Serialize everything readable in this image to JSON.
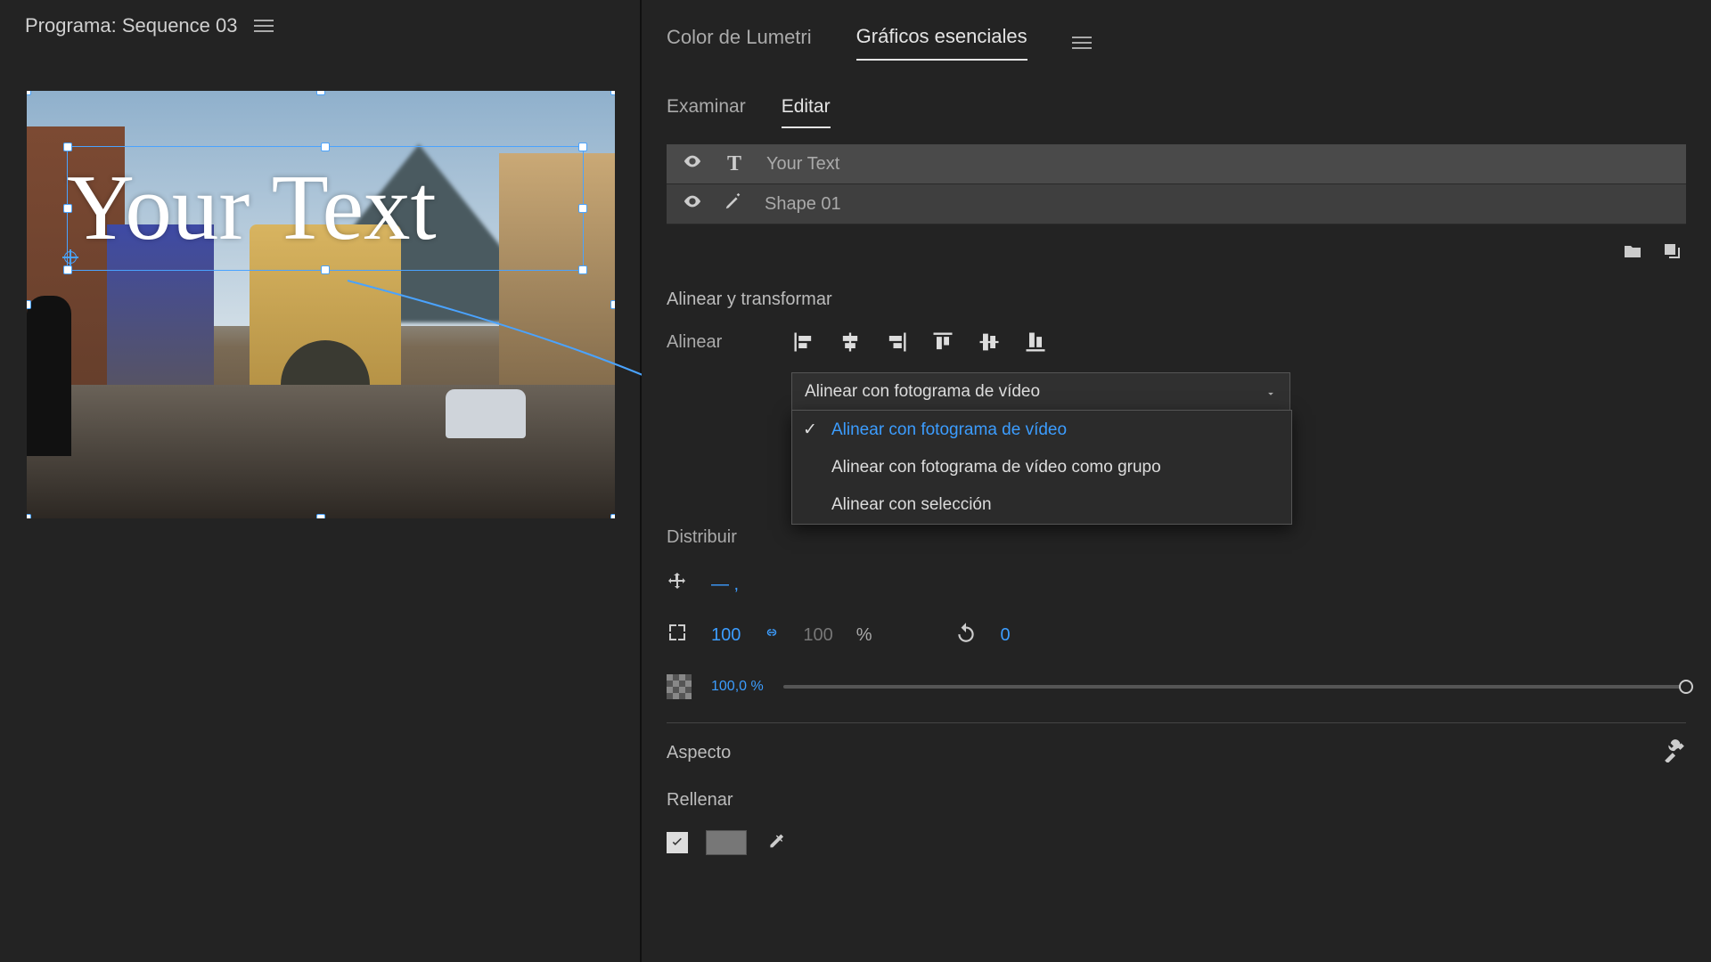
{
  "program": {
    "label": "Programa: Sequence 03"
  },
  "panelTabs": {
    "lumetri": "Color de Lumetri",
    "graphics": "Gráficos esenciales"
  },
  "subTabs": {
    "browse": "Examinar",
    "edit": "Editar"
  },
  "layers": [
    {
      "name": "Your Text",
      "kind": "text"
    },
    {
      "name": "Shape 01",
      "kind": "shape"
    }
  ],
  "canvasText": "Your Text",
  "section": {
    "alignTransform": "Alinear y transformar",
    "align": "Alinear",
    "distribute": "Distribuir",
    "aspect": "Aspecto",
    "fill": "Rellenar"
  },
  "alignDropdown": {
    "selected": "Alinear con fotograma de vídeo",
    "options": [
      "Alinear con fotograma de vídeo",
      "Alinear con fotograma de vídeo como grupo",
      "Alinear con selección"
    ]
  },
  "transform": {
    "posPlaceholder": "— ,",
    "scale": "100",
    "scaleLinked": "100",
    "pct": "%",
    "rotation": "0",
    "opacity": "100,0 %"
  }
}
